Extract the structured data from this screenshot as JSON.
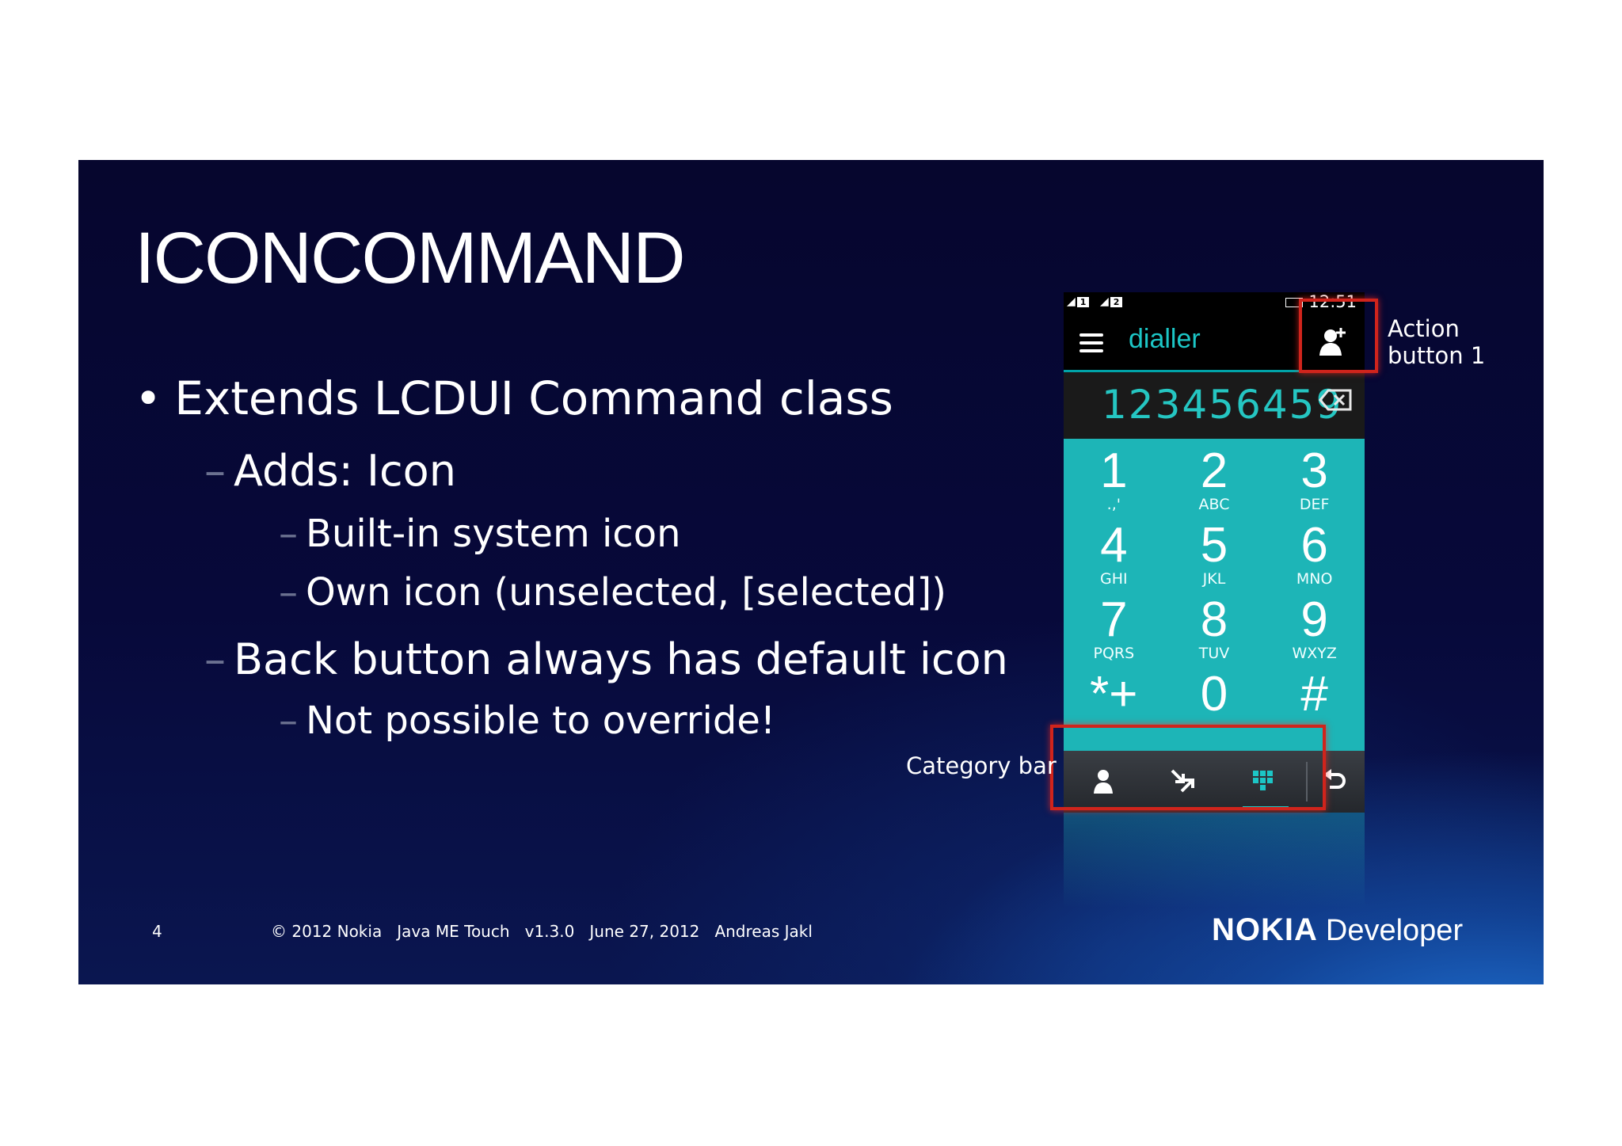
{
  "slide": {
    "title": "ICONCOMMAND",
    "bullets": {
      "b1": "Extends LCDUI Command class",
      "b2": "Adds: Icon",
      "b3": "Built-in system icon",
      "b4": "Own icon (unselected, [selected])",
      "b5": "Back button always has default icon",
      "b6": "Not possible to override!"
    },
    "bullet_symbol": "•",
    "dash_symbol": "–"
  },
  "phone": {
    "sim1": "1",
    "sim2": "2",
    "time": "12:51",
    "header_title": "dialler",
    "number": "123456459",
    "keys": [
      {
        "digit": "1",
        "letters": ".,'"
      },
      {
        "digit": "2",
        "letters": "ABC"
      },
      {
        "digit": "3",
        "letters": "DEF"
      },
      {
        "digit": "4",
        "letters": "GHI"
      },
      {
        "digit": "5",
        "letters": "JKL"
      },
      {
        "digit": "6",
        "letters": "MNO"
      },
      {
        "digit": "7",
        "letters": "PQRS"
      },
      {
        "digit": "8",
        "letters": "TUV"
      },
      {
        "digit": "9",
        "letters": "WXYZ"
      },
      {
        "digit": "*+",
        "letters": ""
      },
      {
        "digit": "0",
        "letters": ""
      },
      {
        "digit": "#",
        "letters": ""
      }
    ],
    "icons": {
      "action": "add-contact-icon",
      "backspace": "backspace-icon",
      "cat1": "contacts-icon",
      "cat2": "call-log-icon",
      "cat3": "keypad-icon",
      "back": "back-icon"
    },
    "accent_color": "#1db5b7"
  },
  "annotations": {
    "action_line1": "Action",
    "action_line2": "button 1",
    "category": "Category bar"
  },
  "footer": {
    "page_number": "4",
    "text": "© 2012 Nokia   Java ME Touch   v1.3.0   June 27, 2012   Andreas Jakl",
    "logo_brand": "NOKIA",
    "logo_sub": "Developer"
  },
  "colors": {
    "slide_bg": "#07093a",
    "highlight_red": "#d0241c"
  }
}
